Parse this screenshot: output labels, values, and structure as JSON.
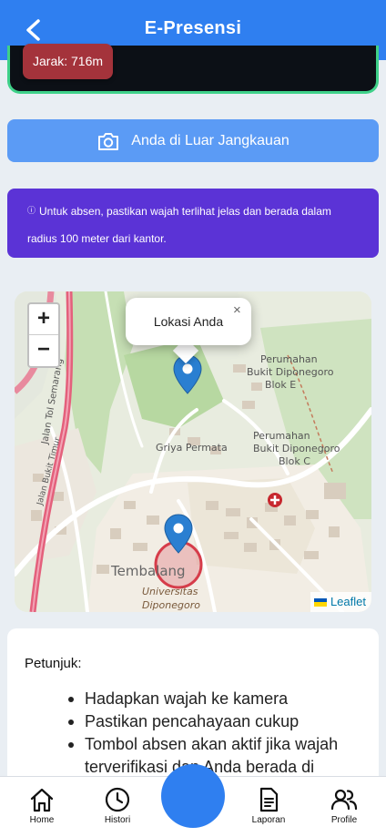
{
  "header": {
    "title": "E-Presensi"
  },
  "camera": {
    "distance_label": "Jarak: 716m"
  },
  "range_button": {
    "label": "Anda di Luar Jangkauan"
  },
  "info": {
    "icon": "info-icon",
    "text": "Untuk absen, pastikan wajah terlihat jelas dan berada dalam radius 100 meter dari kantor."
  },
  "map": {
    "popup_text": "Lokasi Anda",
    "popup_close": "×",
    "zoom_in": "+",
    "zoom_out": "−",
    "attribution": "Leaflet",
    "labels": {
      "perumahan_e_1": "Perumahan",
      "perumahan_e_2": "Bukit Diponegoro",
      "perumahan_e_3": "Blok E",
      "griya": "Griya Permata",
      "perumahan_c_1": "Perumahan",
      "perumahan_c_2": "Bukit Diponegoro",
      "perumahan_c_3": "Blok C",
      "tembalang": "Tembalang",
      "univ_1": "Universitas",
      "univ_2": "Diponegoro",
      "tol": "Jalan Tol Semarang",
      "jalan": "Jalan Bukit Timur"
    }
  },
  "instructions": {
    "title": "Petunjuk:",
    "items": [
      "Hadapkan wajah ke kamera",
      "Pastikan pencahayaan cukup",
      "Tombol absen akan aktif jika wajah terverifikasi dan Anda berada di dalam"
    ]
  },
  "nav": {
    "home": "Home",
    "histori": "Histori",
    "laporan": "Laporan",
    "profile": "Profile"
  },
  "colors": {
    "primary": "#2f7ff0",
    "danger_badge": "#a4333b",
    "info_bg": "#5b33d6",
    "range_btn": "#5b9bf5",
    "camera_border": "#3fd189"
  }
}
